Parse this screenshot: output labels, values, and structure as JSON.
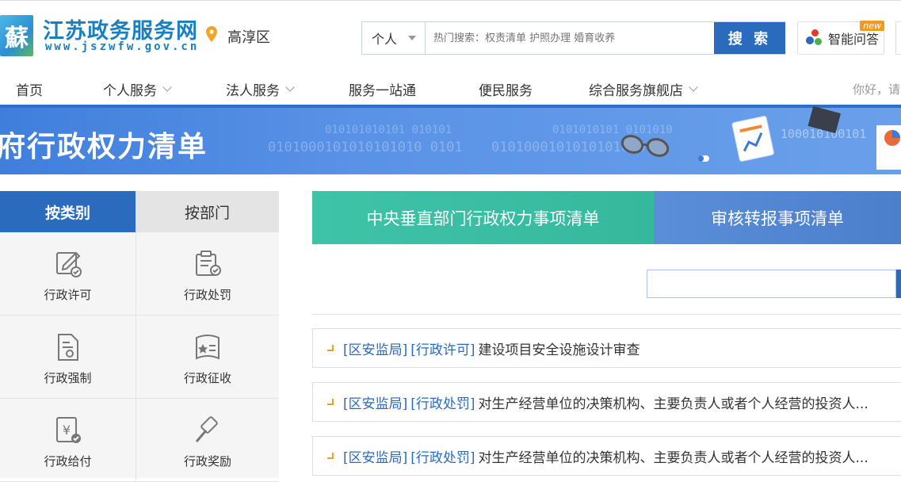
{
  "header": {
    "logo_char": "蘇",
    "site_name": "江苏政务服务网",
    "site_url": "www.jszwfw.gov.cn",
    "location": "高淳区",
    "search": {
      "scope": "个人",
      "placeholder": "热门搜索：权责清单 护照办理 婚育收养",
      "button": "搜 索"
    },
    "qa": {
      "label": "智能问答",
      "badge": "new"
    }
  },
  "nav": {
    "items": [
      {
        "label": "首页"
      },
      {
        "label": "个人服务"
      },
      {
        "label": "法人服务"
      },
      {
        "label": "服务一站通"
      },
      {
        "label": "便民服务"
      },
      {
        "label": "综合服务旗舰店"
      }
    ],
    "greeting": "你好，请"
  },
  "banner": {
    "title": "府行政权力清单",
    "binary_1": "010101010101 010101",
    "binary_2": "0101000101010101010   0101",
    "binary_3": "0101010101 0101010",
    "binary_4": "0101000101010101010",
    "binary_5": "100010100101"
  },
  "left_tabs": {
    "by_category": "按类别",
    "by_department": "按部门"
  },
  "categories": [
    {
      "label": "行政许可",
      "icon": "edit-check-icon"
    },
    {
      "label": "行政处罚",
      "icon": "clipboard-check-icon"
    },
    {
      "label": "行政强制",
      "icon": "document-seal-icon"
    },
    {
      "label": "行政征收",
      "icon": "star-book-icon"
    },
    {
      "label": "行政给付",
      "icon": "yuan-check-icon"
    },
    {
      "label": "行政奖励",
      "icon": "gavel-icon"
    }
  ],
  "list_tabs": {
    "central": "中央垂直部门行政权力事项清单",
    "review": "审核转报事项清单"
  },
  "items": [
    {
      "dept": "[区安监局]",
      "type": "[行政许可]",
      "title": "建设项目安全设施设计审查"
    },
    {
      "dept": "[区安监局]",
      "type": "[行政处罚]",
      "title": "对生产经营单位的决策机构、主要负责人或者个人经营的投资人..."
    },
    {
      "dept": "[区安监局]",
      "type": "[行政处罚]",
      "title": "对生产经营单位的决策机构、主要负责人或者个人经营的投资人..."
    }
  ],
  "colors": {
    "primary": "#2a6bbd",
    "green_tab": "#3fc3a8",
    "banner": "#4a86e0",
    "accent_orange": "#f0a020"
  }
}
